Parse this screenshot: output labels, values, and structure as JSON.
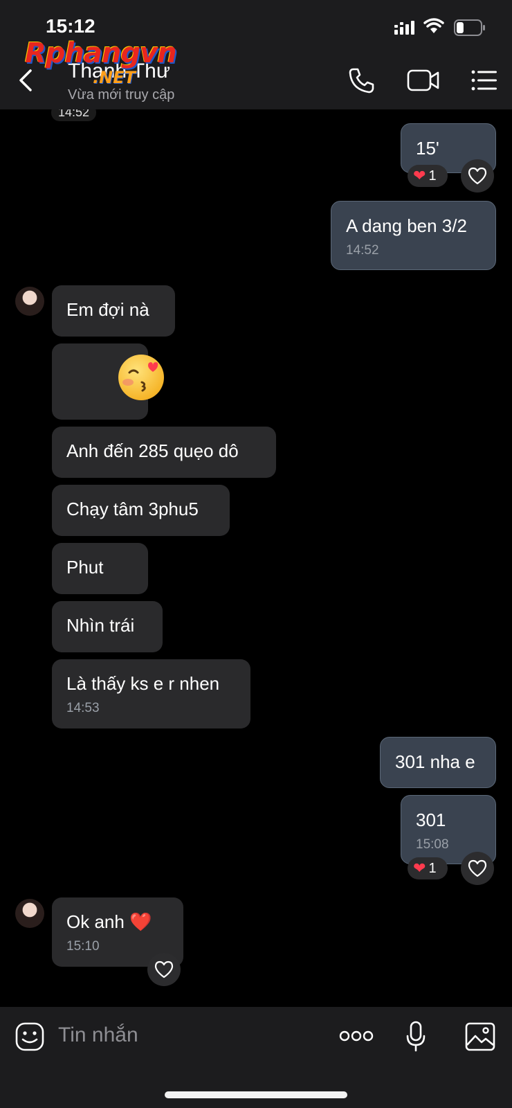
{
  "status_bar": {
    "time": "15:12",
    "battery_level": 0.3
  },
  "header": {
    "title": "Thanh Thư",
    "subtitle": "Vừa mới truy cập",
    "icons": [
      "back-chevron-icon",
      "phone-icon",
      "video-call-icon",
      "menu-list-icon"
    ]
  },
  "watermark": {
    "brand": "Rphangvn",
    "domain": ".NET"
  },
  "chat": {
    "stray_time": "14:52",
    "messages": [
      {
        "direction": "out",
        "text": "15'",
        "reaction": {
          "emoji": "❤",
          "count": "1"
        }
      },
      {
        "direction": "out",
        "text": "A dang ben 3/2",
        "time": "14:52"
      },
      {
        "direction": "in",
        "text": "Em đợi nà"
      },
      {
        "direction": "in",
        "sticker": "kissing-face-heart-eyes"
      },
      {
        "direction": "in",
        "text": "Anh đến 285 quẹo dô"
      },
      {
        "direction": "in",
        "text": "Chạy tâm 3phu5"
      },
      {
        "direction": "in",
        "text": "Phut"
      },
      {
        "direction": "in",
        "text": "Nhìn trái"
      },
      {
        "direction": "in",
        "text": "Là thấy ks e r nhen",
        "time": "14:53"
      },
      {
        "direction": "out",
        "text": "301 nha e"
      },
      {
        "direction": "out",
        "text": "301",
        "time": "15:08",
        "reaction": {
          "emoji": "❤",
          "count": "1"
        }
      },
      {
        "direction": "in",
        "text": "Ok anh ❤️",
        "time": "15:10"
      }
    ]
  },
  "input": {
    "placeholder": "Tin nhắn",
    "icons": [
      "sticker-icon",
      "more-icon",
      "microphone-icon",
      "gallery-icon"
    ]
  },
  "colors": {
    "background": "#000000",
    "bar": "#1c1c1e",
    "incoming_bubble": "#2a2a2c",
    "outgoing_bubble": "#3a4350",
    "reaction_heart": "#ff3b4e"
  }
}
